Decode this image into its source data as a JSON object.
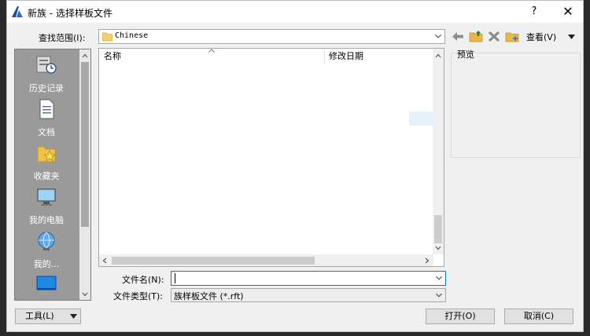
{
  "window": {
    "title": "新族 - 选择样板文件",
    "help_glyph": "?",
    "close_glyph": "✕"
  },
  "toolbar": {
    "look_in_label": "查找范围(I):",
    "look_in_value": "Chinese",
    "back_icon": "back-arrow-icon",
    "up_icon": "up-folder-icon",
    "delete_icon": "delete-x-icon",
    "new_folder_icon": "new-folder-icon",
    "view_label": "查看(V)"
  },
  "places": [
    {
      "label": "历史记录",
      "icon": "history-icon"
    },
    {
      "label": "文档",
      "icon": "documents-icon"
    },
    {
      "label": "收藏夹",
      "icon": "favorites-icon"
    },
    {
      "label": "我的电脑",
      "icon": "computer-icon"
    },
    {
      "label": "我的...",
      "icon": "network-globe-icon"
    },
    {
      "label": "",
      "icon": "desktop-icon"
    }
  ],
  "file_list": {
    "columns": [
      "名称",
      "修改日期"
    ]
  },
  "preview": {
    "label": "预览"
  },
  "form": {
    "filename_label": "文件名(N):",
    "filename_value": "",
    "filetype_label": "文件类型(T):",
    "filetype_value": "族样板文件 (*.rft)"
  },
  "buttons": {
    "tools": "工具(L)",
    "open": "打开(O)",
    "cancel": "取消(C)"
  },
  "colors": {
    "accent": "#0078d7",
    "places_bg": "#9a9a9a",
    "folder": "#f4d06b"
  }
}
